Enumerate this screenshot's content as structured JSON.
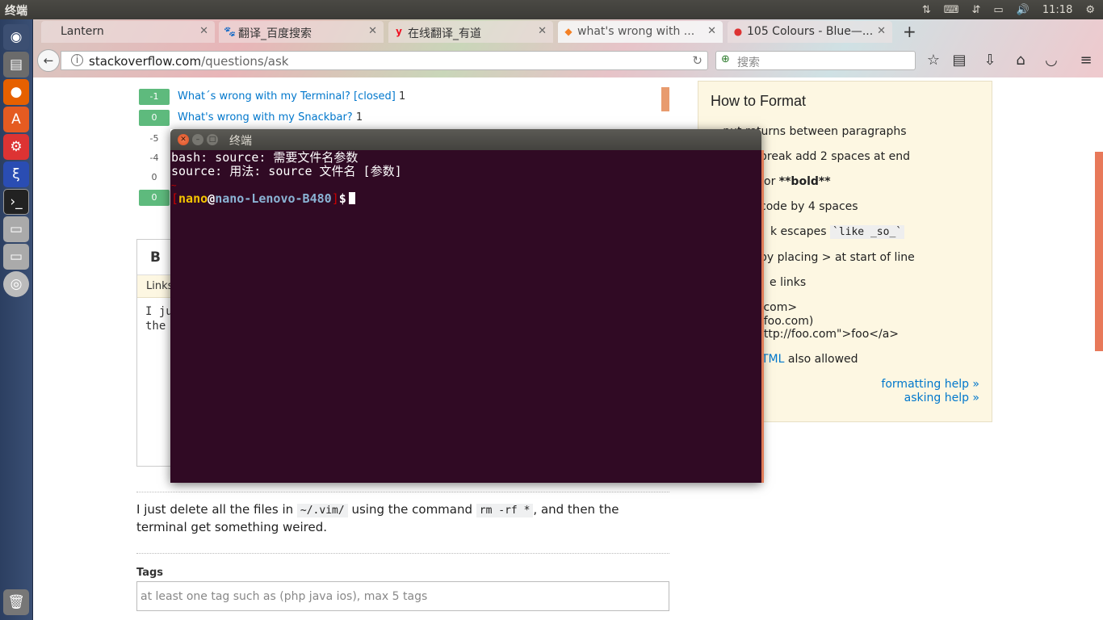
{
  "panel": {
    "title": "终端",
    "time": "11:18"
  },
  "browser": {
    "tabs": [
      {
        "label": "Lantern",
        "icon": ""
      },
      {
        "label": "翻译_百度搜索",
        "icon": "🐾"
      },
      {
        "label": "在线翻译_有道",
        "icon": "y"
      },
      {
        "label": "what's wrong with ...",
        "icon": "◆"
      },
      {
        "label": "105 Colours - Blue—...",
        "icon": "●"
      }
    ],
    "new_tab": "+",
    "url_host": "stackoverflow.com",
    "url_path": "/questions/ask",
    "search_placeholder": "搜索"
  },
  "similar_questions": [
    {
      "votes": "-1",
      "title": "What´s wrong with my Terminal? [closed]",
      "answers": "1",
      "green": true
    },
    {
      "votes": "0",
      "title": "What's wrong with my Snackbar?",
      "answers": "1",
      "green": true
    },
    {
      "votes": "-5",
      "title": "",
      "answers": "",
      "green": false
    },
    {
      "votes": "-4",
      "title": "",
      "answers": "",
      "green": false
    },
    {
      "votes": "0",
      "title": "",
      "answers": "",
      "green": false
    },
    {
      "votes": "0",
      "title": "",
      "answers": "",
      "green": true
    }
  ],
  "editor": {
    "bold": "B",
    "links_hint": "Links",
    "text_line1": "I ju",
    "text_line2": "the "
  },
  "preview": {
    "part1": "I just delete all the files in ",
    "code1": "~/.vim/",
    "part2": " using the command ",
    "code2": "rm -rf *",
    "part3": ", and then the terminal get something weired."
  },
  "tags": {
    "label": "Tags",
    "placeholder": "at least one tag such as (php java ios), max 5 tags"
  },
  "how_to_format": {
    "title": "How to Format",
    "items": [
      "► put returns between paragraphs",
      "break add 2 spaces at end",
      "or",
      "code by 4 spaces",
      "k escapes",
      "by placing > at start of line",
      "e links",
      ".com>",
      "/foo.com)",
      "http://foo.com\">foo</a>",
      "also allowed"
    ],
    "bold_text": "**bold**",
    "code_like": "`like _so_`",
    "html_link": "TML",
    "formatting_help": "formatting help »",
    "asking_help": "asking help »"
  },
  "terminal": {
    "title": "终端",
    "line1": "bash: source: 需要文件名参数",
    "line2": "source: 用法: source 文件名 [参数]",
    "tilde": "~",
    "user": "nano",
    "at": "@",
    "host": "nano-Lenovo-B480",
    "prompt_open": "[",
    "prompt_close": "]",
    "prompt": "$"
  }
}
